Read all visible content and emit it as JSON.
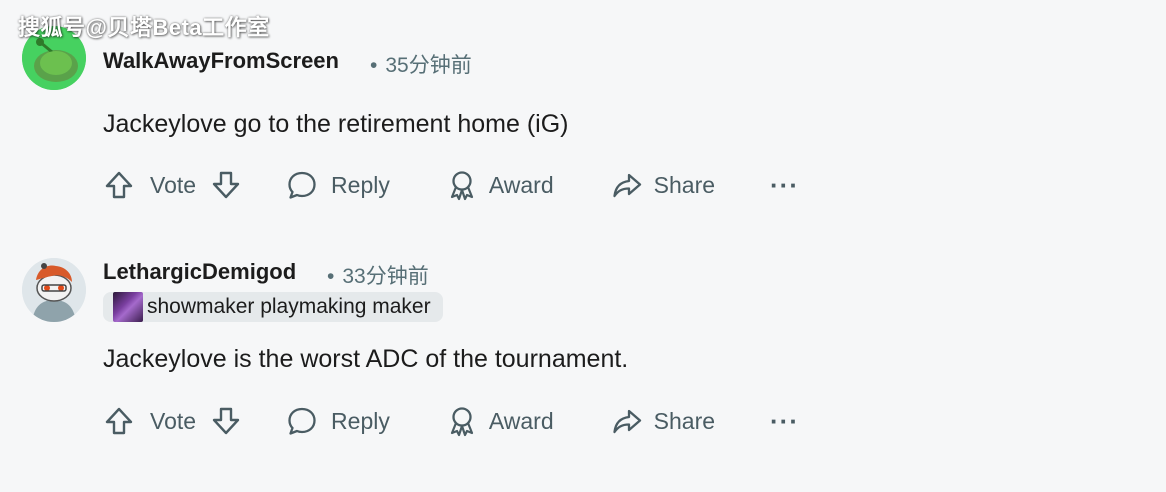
{
  "watermark": "搜狐号@贝塔Beta工作室",
  "comments": [
    {
      "username": "WalkAwayFromScreen",
      "timestamp": "35分钟前",
      "separator": "•",
      "flair": null,
      "body": "Jackeylove go to the retirement home (iG)",
      "actions": {
        "vote": "Vote",
        "reply": "Reply",
        "award": "Award",
        "share": "Share",
        "more": "···"
      }
    },
    {
      "username": "LethargicDemigod",
      "timestamp": "33分钟前",
      "separator": "•",
      "flair": "showmaker playmaking maker",
      "body": "Jackeylove is the worst ADC of the tournament.",
      "actions": {
        "vote": "Vote",
        "reply": "Reply",
        "award": "Award",
        "share": "Share",
        "more": "···"
      }
    }
  ],
  "icons": {
    "upvote": "arrow-up-icon",
    "downvote": "arrow-down-icon",
    "reply": "speech-bubble-icon",
    "award": "award-ribbon-icon",
    "share": "share-arrow-icon",
    "more": "more-dots-icon"
  },
  "colors": {
    "background": "#f6f7f8",
    "text": "#1c1c1c",
    "muted": "#576f76",
    "flair_bg": "#e5e9eb",
    "avatar1": "#46d160"
  }
}
